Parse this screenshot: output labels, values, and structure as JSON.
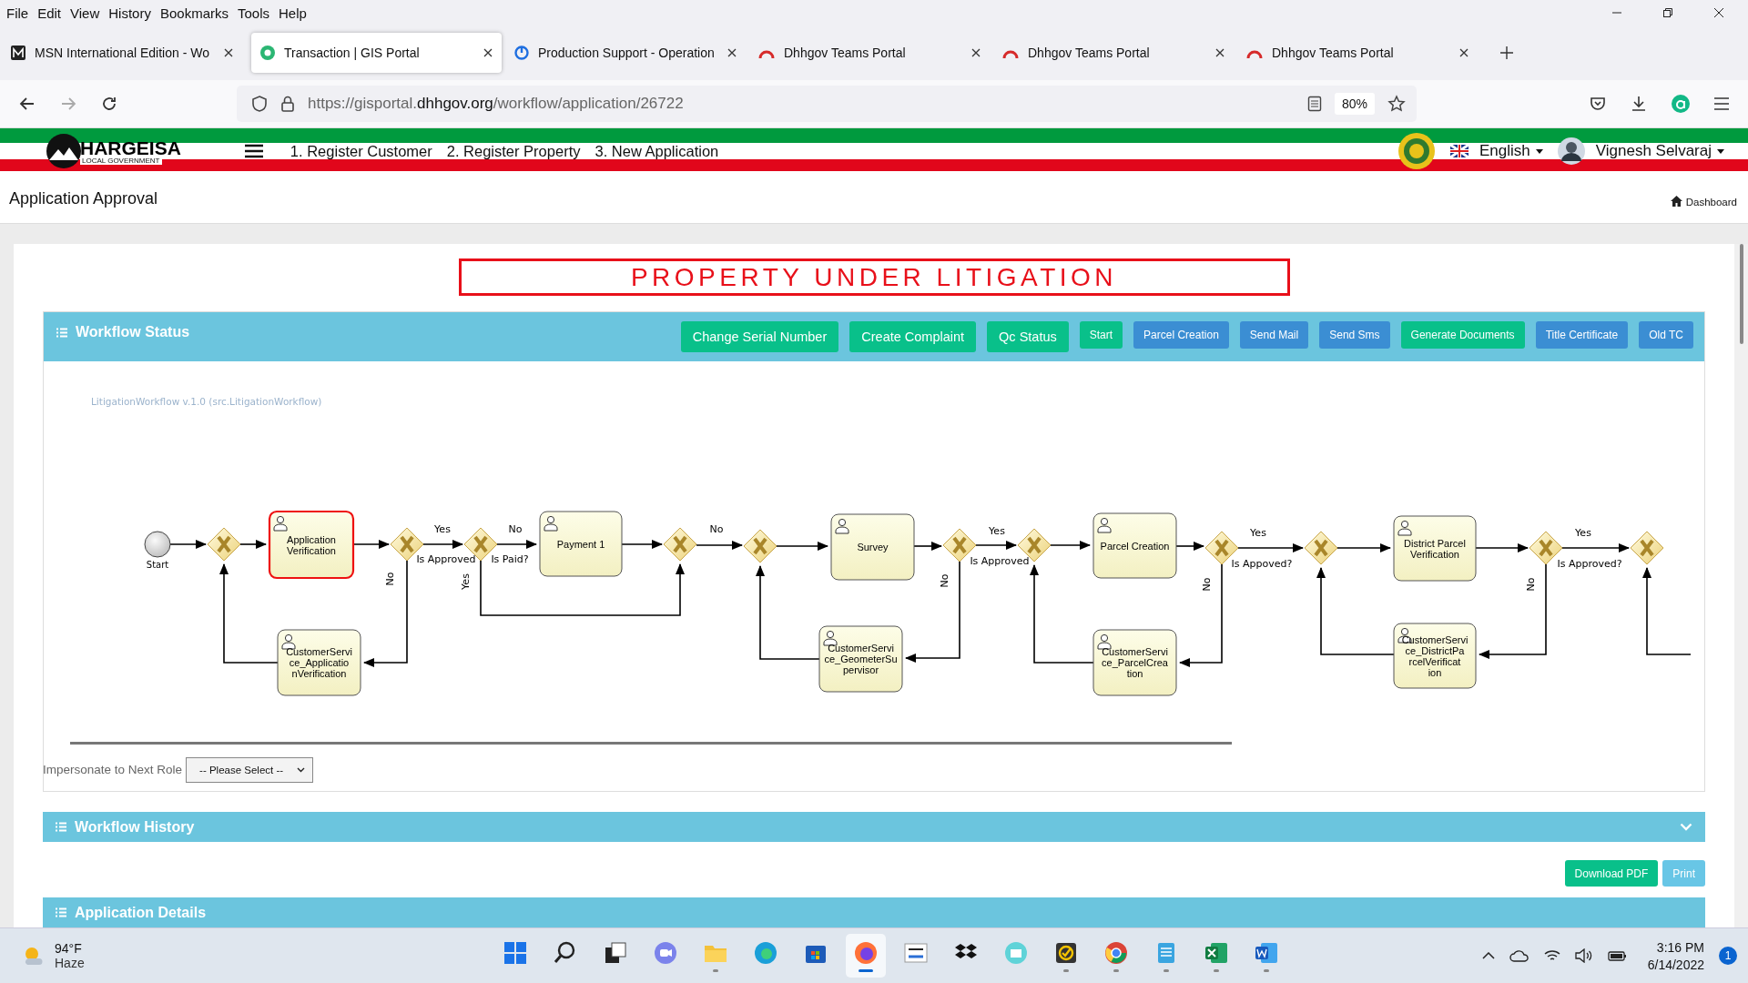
{
  "menu_bar": [
    "File",
    "Edit",
    "View",
    "History",
    "Bookmarks",
    "Tools",
    "Help"
  ],
  "tabs": [
    {
      "title": "MSN International Edition - Wo",
      "selected": false
    },
    {
      "title": "Transaction | GIS Portal",
      "selected": true
    },
    {
      "title": "Production Support - Operation",
      "selected": false
    },
    {
      "title": "Dhhgov Teams Portal",
      "selected": false
    },
    {
      "title": "Dhhgov Teams Portal",
      "selected": false
    },
    {
      "title": "Dhhgov Teams Portal",
      "selected": false
    }
  ],
  "address_bar": {
    "url_start": "https://gisportal.",
    "url_domain": "dhhgov.org",
    "url_path": "/workflow/application/26722",
    "zoom": "80%"
  },
  "site_header": {
    "logo": "HARGEISA",
    "logo_subtitle": "LOCAL GOVERNMENT",
    "nav": [
      "1. Register Customer",
      "2. Register Property",
      "3. New Application"
    ],
    "language": "English",
    "user": "Vignesh Selvaraj"
  },
  "page": {
    "title": "Application Approval",
    "breadcrumb": "Dashboard"
  },
  "alert_banner": "PROPERTY UNDER LITIGATION",
  "workflow_status": {
    "title": "Workflow Status",
    "buttons": [
      {
        "label": "Change Serial Number",
        "kind": "success"
      },
      {
        "label": "Create Complaint",
        "kind": "success"
      },
      {
        "label": "Qc Status",
        "kind": "success"
      },
      {
        "label": "Start",
        "kind": "success"
      },
      {
        "label": "Parcel Creation",
        "kind": "primary"
      },
      {
        "label": "Send Mail",
        "kind": "primary"
      },
      {
        "label": "Send Sms",
        "kind": "primary"
      },
      {
        "label": "Generate Documents",
        "kind": "success"
      },
      {
        "label": "Title Certificate",
        "kind": "primary"
      },
      {
        "label": "Old TC",
        "kind": "primary"
      }
    ],
    "diagram": {
      "title": "LitigationWorkflow v.1.0 (src.LitigationWorkflow)",
      "nodes": [
        {
          "kind": "start",
          "label": "Start"
        },
        {
          "kind": "gateway"
        },
        {
          "kind": "task",
          "label": "Application Verification",
          "active": true
        },
        {
          "kind": "gateway"
        },
        {
          "kind": "gateway"
        },
        {
          "kind": "task",
          "label": "Payment 1",
          "active": false
        },
        {
          "kind": "gateway"
        },
        {
          "kind": "gateway"
        },
        {
          "kind": "task",
          "label": "Survey",
          "active": false
        },
        {
          "kind": "gateway"
        },
        {
          "kind": "gateway"
        },
        {
          "kind": "task",
          "label": "Parcel Creation",
          "active": false
        },
        {
          "kind": "gateway"
        },
        {
          "kind": "gateway"
        },
        {
          "kind": "task",
          "label": "District Parcel Verification",
          "active": false
        },
        {
          "kind": "gateway"
        },
        {
          "kind": "gateway"
        },
        {
          "kind": "task",
          "label": "CustomerService_ApplicationVerification",
          "active": false
        },
        {
          "kind": "task",
          "label": "CustomerService_GeometerSupervisor",
          "active": false
        },
        {
          "kind": "task",
          "label": "CustomerService_ParcelCreation",
          "active": false
        },
        {
          "kind": "task",
          "label": "CustomerService_DistrictParcelVerification",
          "active": false
        }
      ],
      "edge_labels": [
        "Yes",
        "Is Approved",
        "No",
        "No",
        "Is Paid?",
        "Yes",
        "No",
        "Yes",
        "Is Approved",
        "No",
        "Yes",
        "Is Appoved?",
        "No",
        "Yes",
        "Is Approved?",
        "No"
      ]
    },
    "impersonate": {
      "label": "Impersonate to Next Role",
      "value": "-- Please Select --"
    }
  },
  "workflow_history": {
    "title": "Workflow History",
    "expanded": false
  },
  "actions": [
    {
      "label": "Download PDF",
      "kind": "success"
    },
    {
      "label": "Print",
      "kind": "info"
    }
  ],
  "application_details": {
    "title": "Application Details"
  },
  "taskbar": {
    "weather": {
      "temperature": "94°F",
      "condition": "Haze"
    },
    "apps": [
      {
        "running": false,
        "selected": false
      },
      {
        "running": false,
        "selected": false
      },
      {
        "running": false,
        "selected": false
      },
      {
        "running": false,
        "selected": false
      },
      {
        "running": true,
        "selected": false
      },
      {
        "running": false,
        "selected": false
      },
      {
        "running": false,
        "selected": false
      },
      {
        "running": true,
        "selected": true
      },
      {
        "running": false,
        "selected": false
      },
      {
        "running": false,
        "selected": false
      },
      {
        "running": false,
        "selected": false
      },
      {
        "running": true,
        "selected": false
      },
      {
        "running": true,
        "selected": false
      },
      {
        "running": true,
        "selected": false
      },
      {
        "running": true,
        "selected": false
      },
      {
        "running": true,
        "selected": false
      }
    ],
    "time": "3:16 PM",
    "date": "6/14/2022",
    "notifications": "1"
  }
}
